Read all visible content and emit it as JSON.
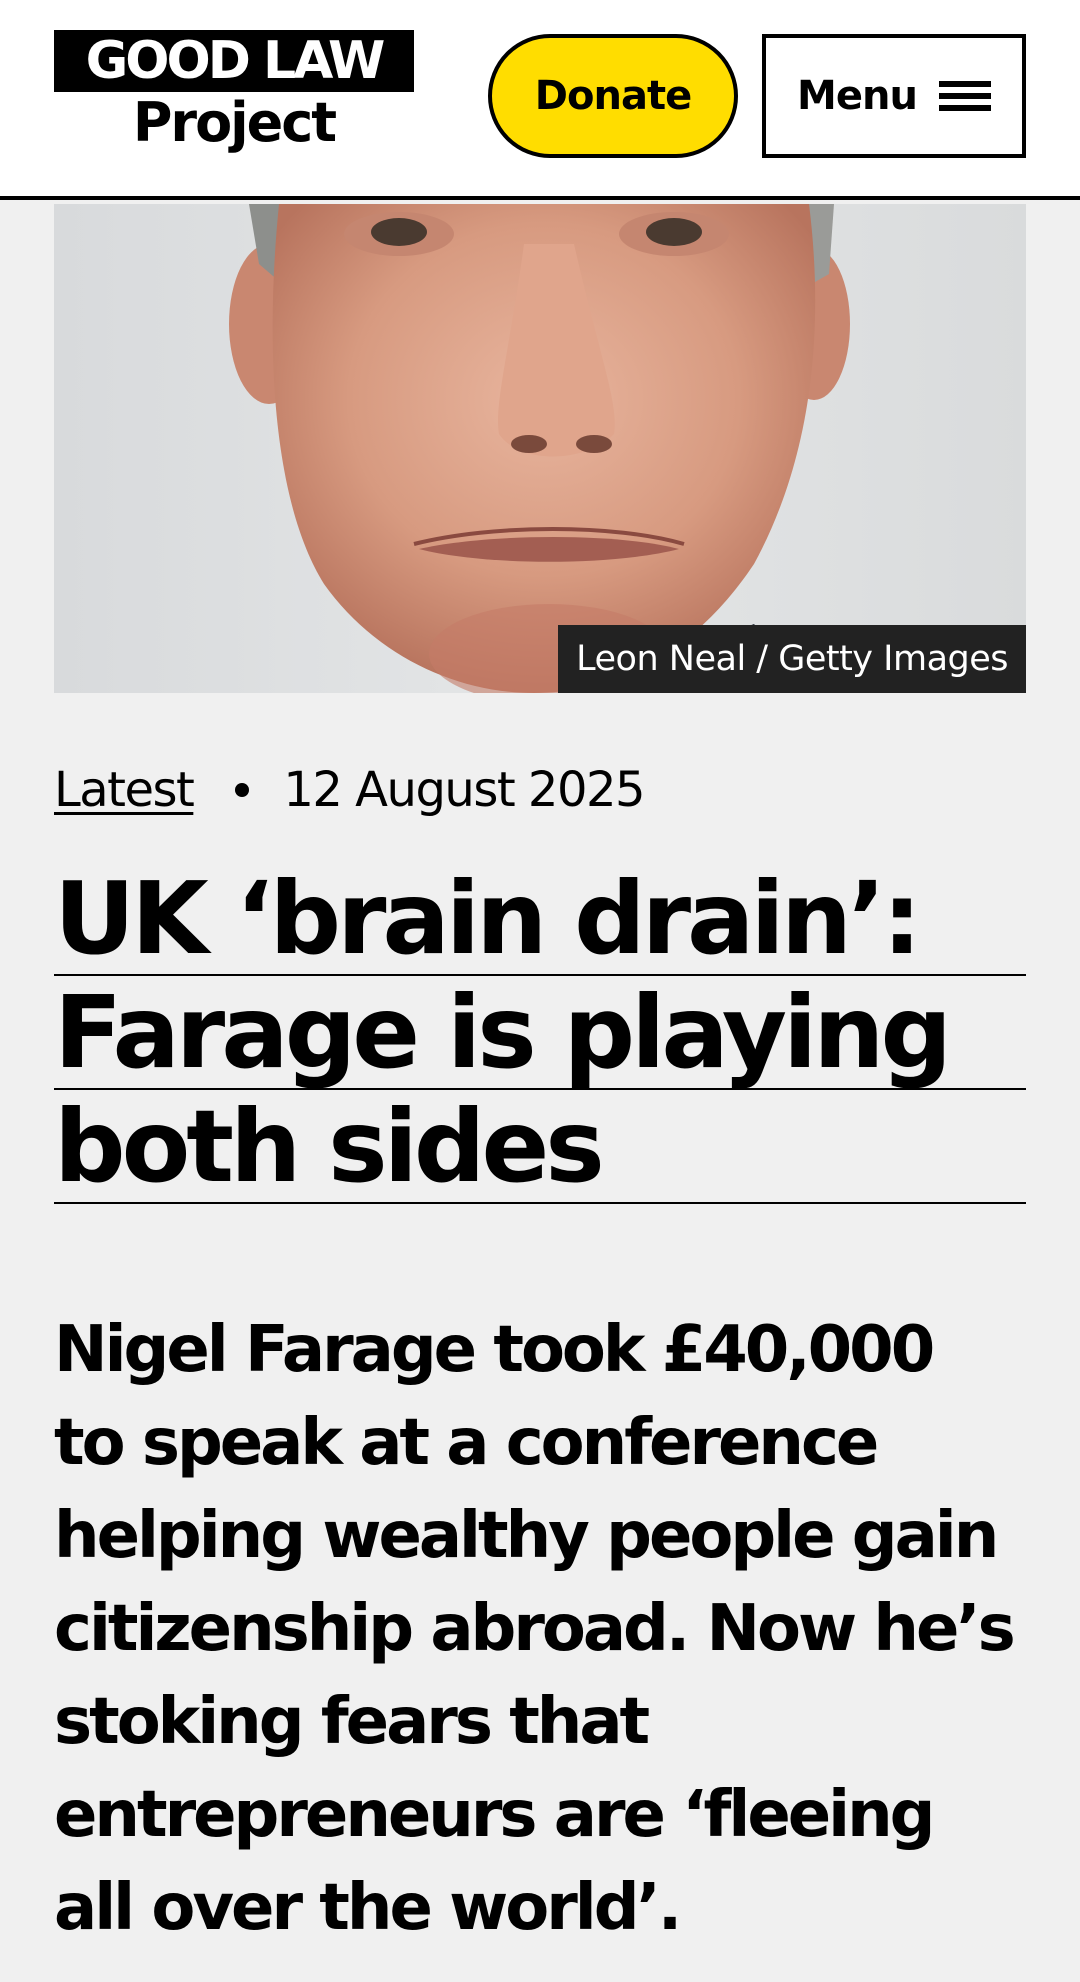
{
  "header": {
    "logo_line1": "GOOD LAW",
    "logo_line2": "Project",
    "donate_label": "Donate",
    "menu_label": "Menu",
    "menu_icon": "hamburger-icon",
    "accent_color": "#ffdd00"
  },
  "hero": {
    "credit": "Leon Neal / Getty Images"
  },
  "article": {
    "category": "Latest",
    "date": "12 August 2025",
    "headline_lines": [
      "UK ‘brain drain’:",
      "Farage is playing",
      "both sides"
    ],
    "standfirst_lines": [
      "Nigel Farage took £40,000",
      "to speak at a conference",
      "helping wealthy people gain",
      "citizenship abroad. Now he’s",
      "stoking fears that",
      "entrepreneurs are ‘fleeing",
      "all over the world’."
    ]
  }
}
